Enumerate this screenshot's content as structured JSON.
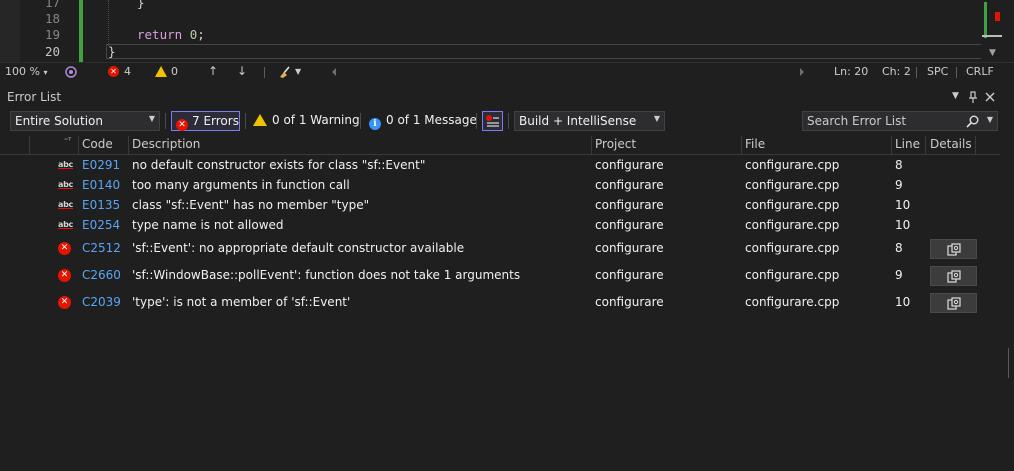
{
  "editor": {
    "line_numbers": [
      "17",
      "18",
      "19",
      "20"
    ],
    "lines": {
      "l17": "}",
      "l19_keyword": "return",
      "l19_value": "0",
      "l19_semicolon": ";",
      "l20": "}"
    },
    "current_line": "20"
  },
  "statusbar": {
    "zoom": "100 %",
    "errors": "4",
    "warnings": "0",
    "position_line": "Ln: 20",
    "position_char": "Ch: 2",
    "indent": "SPC",
    "line_ending": "CRLF"
  },
  "panel": {
    "title": "Error List"
  },
  "toolbar": {
    "scope": "Entire Solution",
    "errors_filter": "7 Errors",
    "warnings_filter": "0 of 1 Warning",
    "messages_filter": "0 of 1 Message",
    "source": "Build + IntelliSense",
    "search_placeholder": "Search Error List"
  },
  "table": {
    "headers": {
      "code": "Code",
      "description": "Description",
      "project": "Project",
      "file": "File",
      "line": "Line",
      "details": "Details"
    },
    "rows": [
      {
        "kind": "intellisense",
        "code": "E0291",
        "description": "no default constructor exists for class \"sf::Event\"",
        "project": "configurare",
        "file": "configurare.cpp",
        "line": "8"
      },
      {
        "kind": "intellisense",
        "code": "E0140",
        "description": "too many arguments in function call",
        "project": "configurare",
        "file": "configurare.cpp",
        "line": "9"
      },
      {
        "kind": "intellisense",
        "code": "E0135",
        "description": "class \"sf::Event\" has no member \"type\"",
        "project": "configurare",
        "file": "configurare.cpp",
        "line": "10"
      },
      {
        "kind": "intellisense",
        "code": "E0254",
        "description": "type name is not allowed",
        "project": "configurare",
        "file": "configurare.cpp",
        "line": "10"
      },
      {
        "kind": "build",
        "code": "C2512",
        "description": "'sf::Event': no appropriate default constructor available",
        "project": "configurare",
        "file": "configurare.cpp",
        "line": "8"
      },
      {
        "kind": "build",
        "code": "C2660",
        "description": "'sf::WindowBase::pollEvent': function does not take 1 arguments",
        "project": "configurare",
        "file": "configurare.cpp",
        "line": "9"
      },
      {
        "kind": "build",
        "code": "C2039",
        "description": "'type': is not a member of 'sf::Event'",
        "project": "configurare",
        "file": "configurare.cpp",
        "line": "10"
      }
    ]
  },
  "colors": {
    "background": "#1f1f1f",
    "error": "#e51400",
    "warning": "#f0c300",
    "info": "#3794ff",
    "code_link": "#5ba4f5",
    "change_bar": "#3fa13f"
  },
  "icons": [
    "error-icon",
    "warning-icon",
    "info-icon",
    "filter-icon",
    "search-icon",
    "pin-icon",
    "close-icon",
    "copy-icon",
    "broom-icon",
    "up-arrow-icon",
    "down-arrow-icon"
  ]
}
